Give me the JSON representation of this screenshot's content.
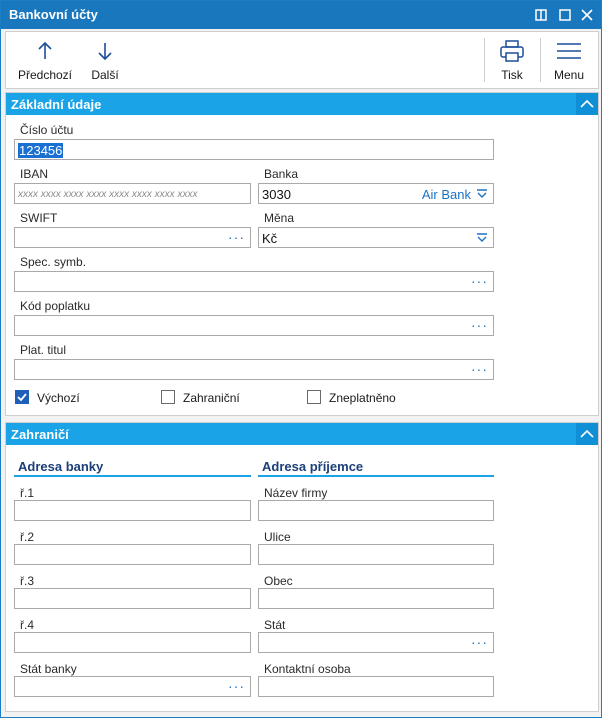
{
  "window": {
    "title": "Bankovní účty"
  },
  "toolbar": {
    "prev": "Předchozí",
    "next": "Další",
    "print": "Tisk",
    "menu": "Menu"
  },
  "basic": {
    "title": "Základní údaje",
    "account_label": "Číslo účtu",
    "account_value": "123456",
    "iban_label": "IBAN",
    "iban_placeholder": "xxxx xxxx xxxx xxxx xxxx xxxx xxxx xxxx",
    "bank_label": "Banka",
    "bank_code": "3030",
    "bank_name": "Air Bank",
    "swift_label": "SWIFT",
    "currency_label": "Měna",
    "currency_value": "Kč",
    "spec_label": "Spec. symb.",
    "fee_label": "Kód poplatku",
    "title_label": "Plat. titul",
    "cb_default": "Výchozí",
    "cb_default_checked": true,
    "cb_foreign": "Zahraniční",
    "cb_foreign_checked": false,
    "cb_invalid": "Zneplatněno",
    "cb_invalid_checked": false
  },
  "foreign": {
    "title": "Zahraničí",
    "bank_address": "Adresa banky",
    "recipient_address": "Adresa příjemce",
    "r1": "ř.1",
    "r2": "ř.2",
    "r3": "ř.3",
    "r4": "ř.4",
    "bank_state": "Stát banky",
    "company": "Název firmy",
    "street": "Ulice",
    "city": "Obec",
    "state": "Stát",
    "contact": "Kontaktní osoba"
  },
  "colors": {
    "titlebar": "#1977bd",
    "section_header": "#1aa3e6",
    "accent": "#1b73c7"
  }
}
